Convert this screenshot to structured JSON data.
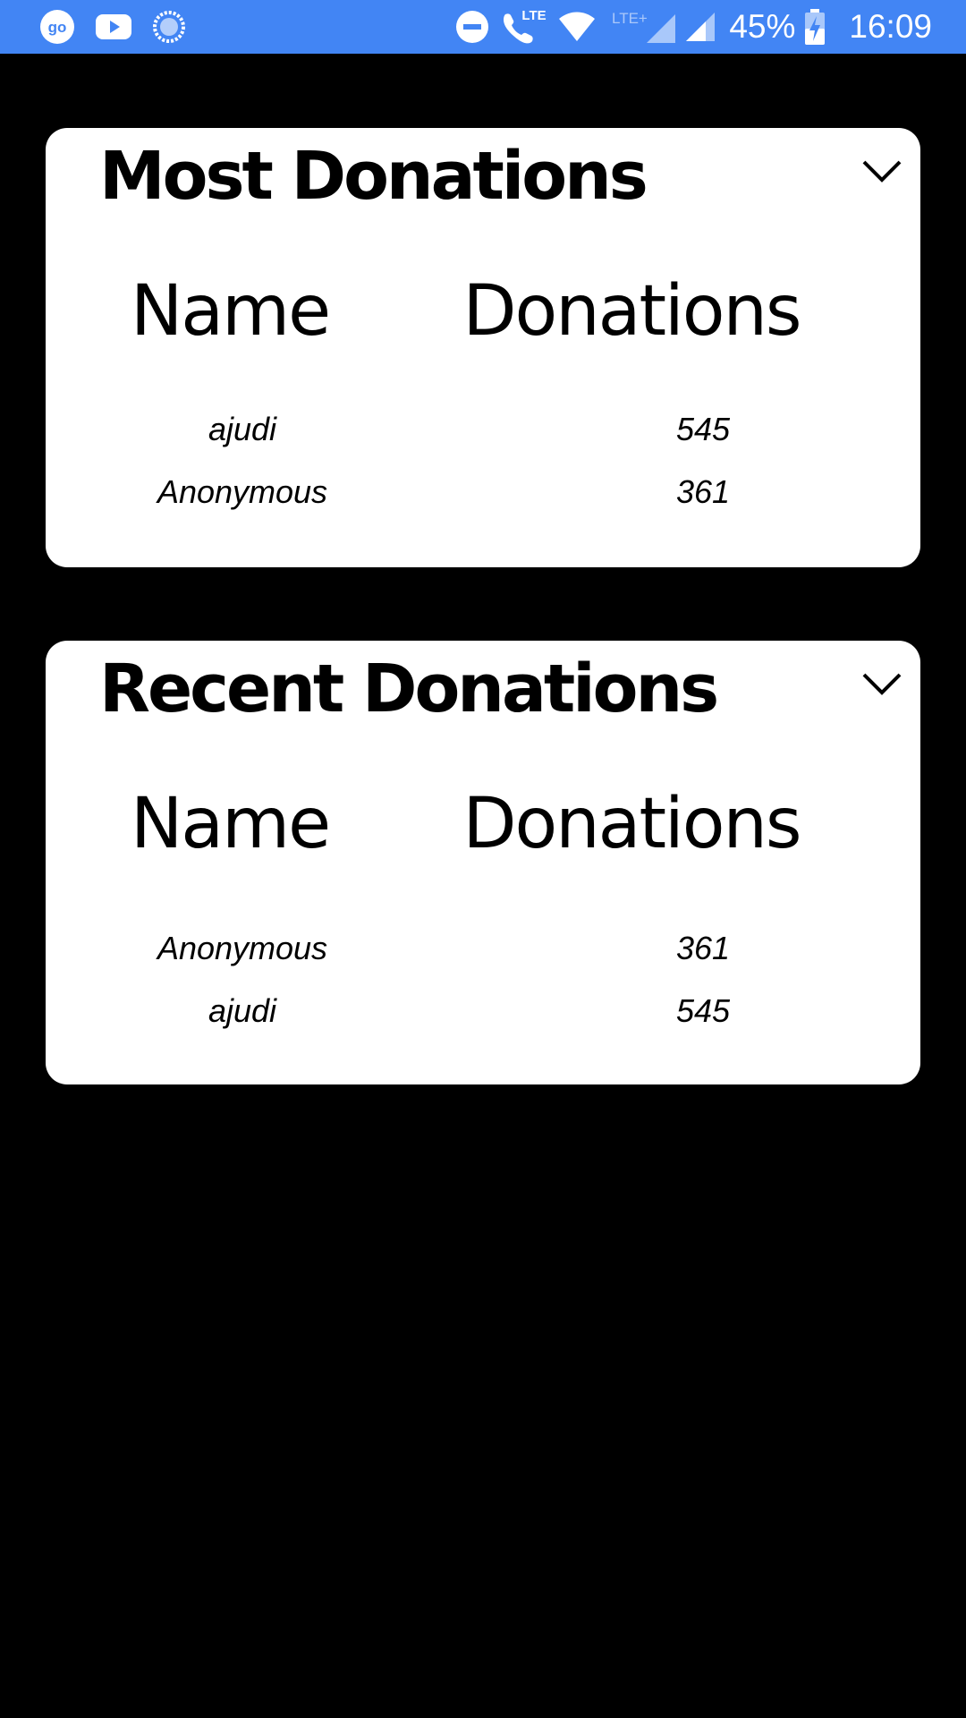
{
  "status_bar": {
    "left_icons": [
      "go-app-icon",
      "youtube-icon",
      "loading-circle-icon"
    ],
    "right_icons": [
      "do-not-disturb-icon",
      "lte-call-icon",
      "wifi-icon",
      "lte-plus-signal-icon",
      "cell-signal-icon",
      "battery-charging-icon"
    ],
    "lte_label": "LTE",
    "lte_plus_label": "LTE+",
    "go_label": "go",
    "battery_percent": "45%",
    "time": "16:09",
    "bar_color": "#4285f4"
  },
  "most_donations": {
    "title": "Most Donations",
    "header_name": "Name",
    "header_donations": "Donations",
    "rows": [
      {
        "name": "ajudi",
        "donations": "545"
      },
      {
        "name": "Anonymous",
        "donations": "361"
      }
    ]
  },
  "recent_donations": {
    "title": "Recent Donations",
    "header_name": "Name",
    "header_donations": "Donations",
    "rows": [
      {
        "name": "Anonymous",
        "donations": "361"
      },
      {
        "name": "ajudi",
        "donations": "545"
      }
    ]
  }
}
